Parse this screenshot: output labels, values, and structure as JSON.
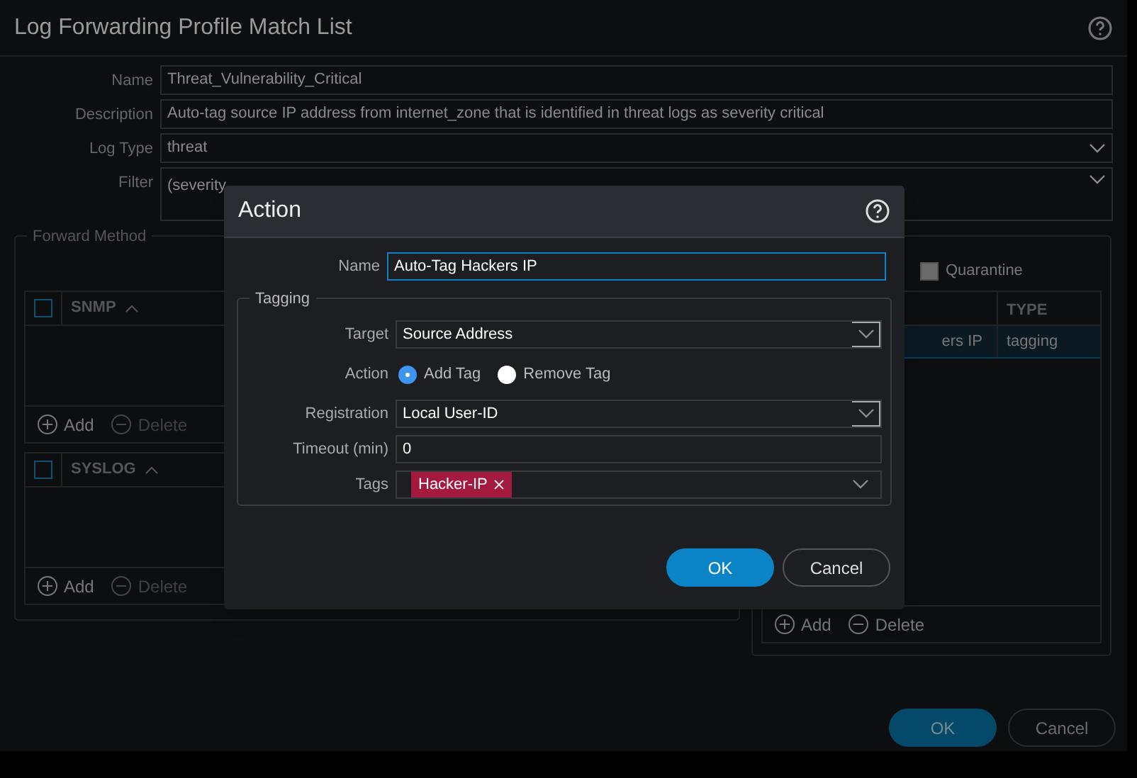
{
  "window": {
    "title": "Log Forwarding Profile Match List"
  },
  "form": [
    {
      "label": "Name",
      "value": "Threat_Vulnerability_Critical",
      "kind": "text"
    },
    {
      "label": "Description",
      "value": "Auto-tag source IP address from internet_zone that is identified in threat logs as severity critical",
      "kind": "text"
    },
    {
      "label": "Log Type",
      "value": "threat",
      "kind": "select"
    },
    {
      "label": "Filter",
      "value": "(severity",
      "kind": "area"
    }
  ],
  "forward_method": {
    "title": "Forward Method",
    "tables": [
      {
        "header": "SNMP",
        "checked": false,
        "add": "Add",
        "delete": "Delete",
        "delete_disabled": true
      },
      {
        "header": "SYSLOG",
        "checked": false,
        "add": "Add",
        "delete": "Delete",
        "delete_disabled": true
      }
    ]
  },
  "built_in_actions": {
    "quarantine": {
      "label": "Quarantine",
      "checked": false
    },
    "columns": [
      "TYPE"
    ],
    "rows": [
      {
        "name": "ers IP",
        "type": "tagging",
        "selected": true
      }
    ],
    "add": "Add",
    "delete": "Delete"
  },
  "buttons": [
    {
      "label": "OK",
      "kind": "primary"
    },
    {
      "label": "Cancel",
      "kind": "secondary"
    }
  ],
  "dialog": {
    "title": "Action",
    "name_label": "Name",
    "name_value": "Auto-Tag Hackers IP",
    "tagging": {
      "title": "Tagging",
      "target_label": "Target",
      "target": "Source Address",
      "action_label": "Action",
      "actions": [
        {
          "label": "Add Tag",
          "selected": true
        },
        {
          "label": "Remove Tag",
          "selected": false
        }
      ],
      "registration_label": "Registration",
      "registration": "Local User-ID",
      "timeout_label": "Timeout (min)",
      "timeout": "0",
      "tags_label": "Tags",
      "tags": [
        {
          "label": "Hacker-IP",
          "color": "#a31a3e"
        }
      ]
    },
    "buttons": [
      {
        "label": "OK",
        "kind": "primary"
      },
      {
        "label": "Cancel",
        "kind": "secondary"
      }
    ]
  }
}
